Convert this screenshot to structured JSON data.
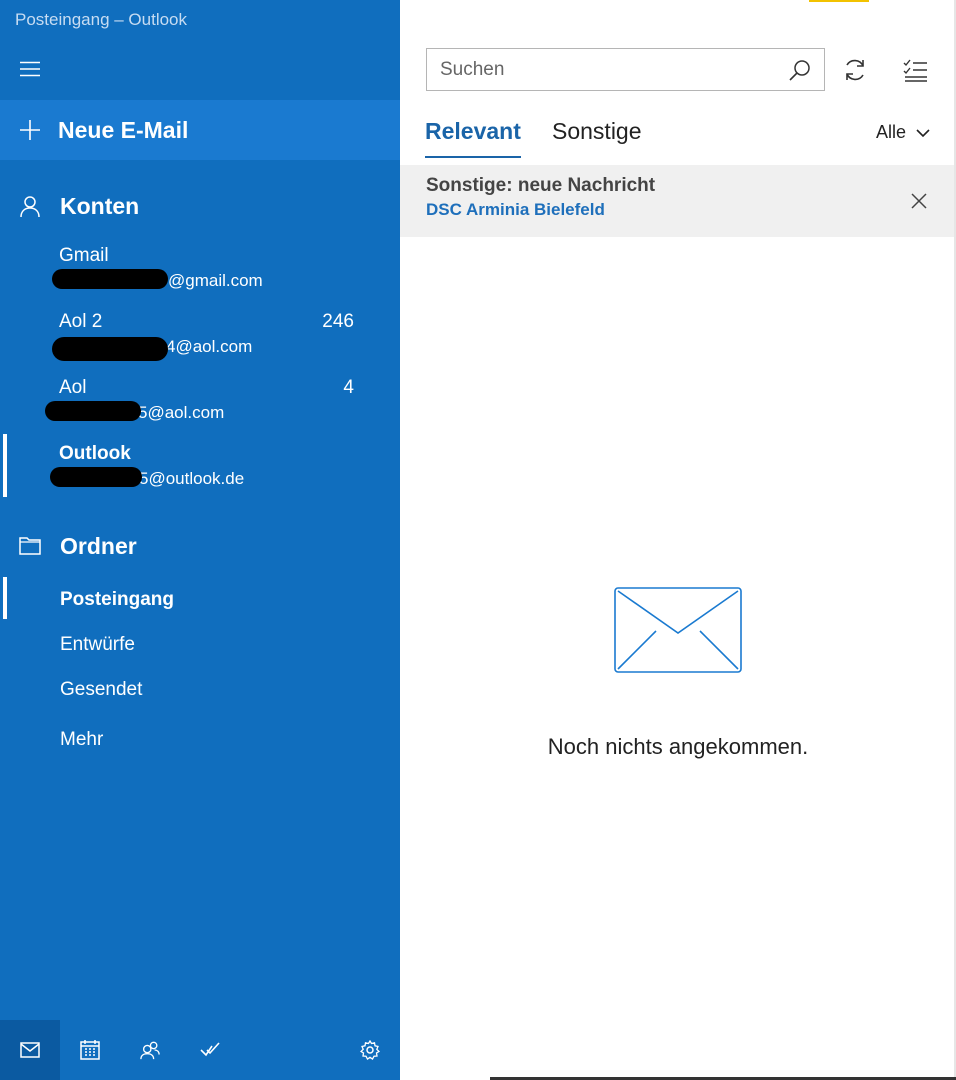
{
  "window": {
    "title": "Posteingang – Outlook"
  },
  "sidebar": {
    "new_mail_label": "Neue E-Mail",
    "accounts_heading": "Konten",
    "accounts": [
      {
        "name": "Gmail",
        "email": "@gmail.com",
        "count": ""
      },
      {
        "name": "Aol 2",
        "email": "4@aol.com",
        "count": "246"
      },
      {
        "name": "Aol",
        "email": "5@aol.com",
        "count": "4"
      },
      {
        "name": "Outlook",
        "email": "5@outlook.de",
        "count": ""
      }
    ],
    "folders_heading": "Ordner",
    "folders": [
      "Posteingang",
      "Entwürfe",
      "Gesendet",
      "Mehr"
    ],
    "bottom_icons": [
      "mail-icon",
      "calendar-icon",
      "people-icon",
      "todo-icon",
      "gear-icon"
    ]
  },
  "main": {
    "search_placeholder": "Suchen",
    "tabs": [
      "Relevant",
      "Sonstige"
    ],
    "filter_label": "Alle",
    "notice": {
      "title": "Sonstige: neue Nachricht",
      "sender": "DSC Arminia Bielefeld"
    },
    "empty_message": "Noch nichts angekommen."
  },
  "colors": {
    "sidebar": "#106ebe",
    "accent": "#1a64a8",
    "link": "#1e6fbb"
  }
}
